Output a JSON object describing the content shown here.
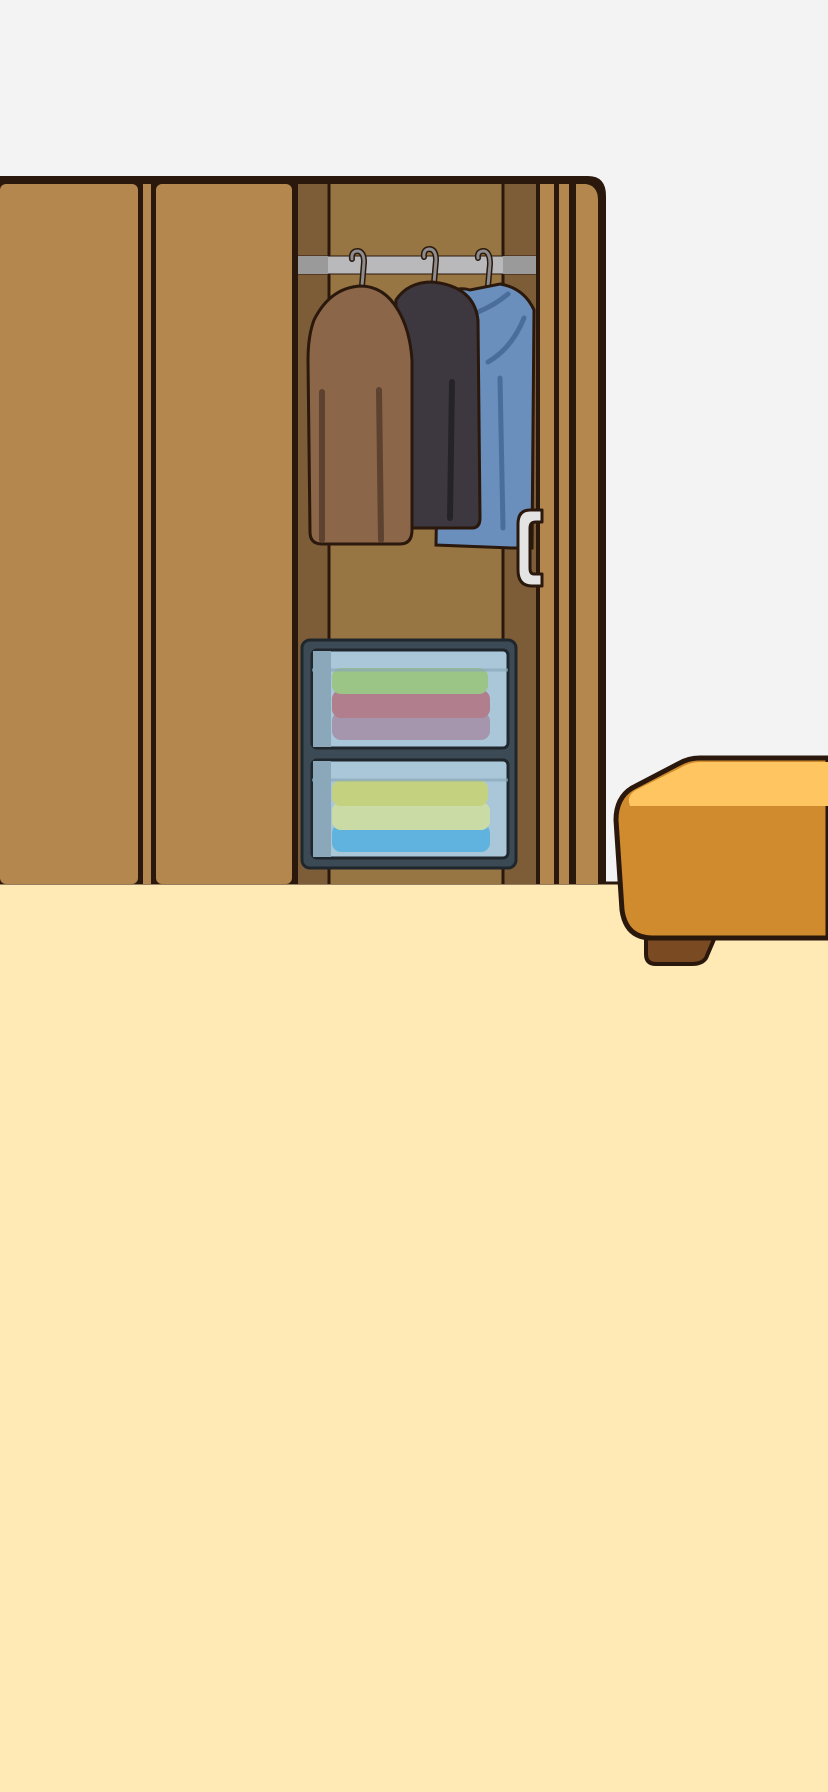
{
  "scene": {
    "name": "bedroom-wardrobe-view",
    "colors": {
      "wall": "#f3f3f3",
      "floor": "#ffe9b4",
      "outline": "#2a180c",
      "wardrobe_door": "#b3874d",
      "wardrobe_interior": "#987644",
      "wardrobe_interior_dark": "#7d5d37",
      "rail": "#b9b9bb",
      "coat_brown": "#8b6648",
      "coat_black": "#3d383f",
      "coat_blue": "#6a8fbd",
      "handle": "#e4e4e4",
      "storage_frame": "#3b4a55",
      "storage_glass": "#a9c7d9",
      "towel_green": "#9bc487",
      "towel_red": "#b07e8c",
      "towel_purple": "#a596ae",
      "towel_lime": "#c4d27f",
      "towel_pale": "#cbdba5",
      "towel_blue": "#61b3df",
      "ottoman_top": "#ffc561",
      "ottoman_side": "#cf8b2d",
      "ottoman_leg": "#7a4a22"
    },
    "objects": [
      "wardrobe",
      "clothes-rail",
      "brown-coat",
      "black-coat",
      "blue-coat",
      "sliding-door-handle",
      "storage-drawer-top",
      "storage-drawer-bottom",
      "ottoman"
    ]
  }
}
